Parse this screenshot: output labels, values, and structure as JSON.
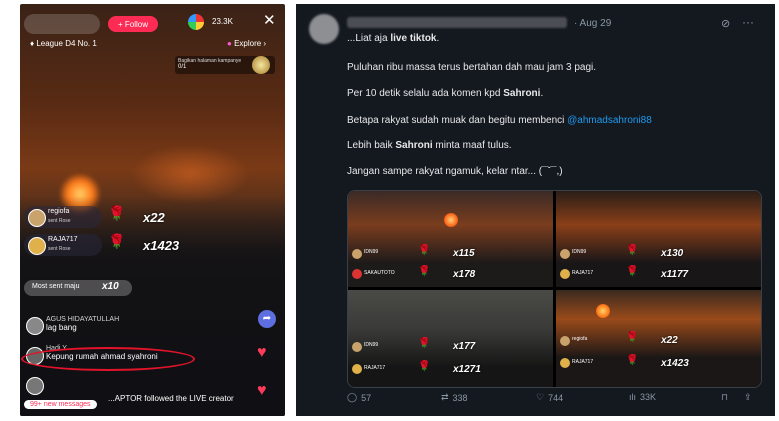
{
  "tiktok": {
    "follow_label": "+ Follow",
    "viewer_count": "23.3K",
    "league": "League D4 No. 1",
    "explore": "Explore",
    "share_page": "Bagikan halaman kampanye",
    "share_count": "0/1",
    "gifts": [
      {
        "user": "regiofa",
        "sub": "sent Rose",
        "count": "x22"
      },
      {
        "user": "RAJA717",
        "sub": "sent Rose",
        "count": "x1423"
      }
    ],
    "most_sent": "Most sent maju",
    "most_sent_count": "x10",
    "comments": [
      {
        "name": "AGUS HIDAYATULLAH",
        "text": "lag bang"
      },
      {
        "name": "Hadi Y...",
        "text": "Kepung rumah ahmad syahroni"
      }
    ],
    "followed_text": "...APTOR followed the LIVE creator",
    "new_messages": "99+ new messages"
  },
  "tweet": {
    "date": "· Aug 29",
    "lines": [
      {
        "pre": "...Liat aja ",
        "bold": "live tiktok",
        "post": "."
      },
      {
        "pre": "Puluhan ribu massa terus bertahan dah mau jam 3 pagi.",
        "bold": "",
        "post": ""
      },
      {
        "pre": "Per 10 detik selalu ada komen kpd ",
        "bold": "Sahroni",
        "post": "."
      },
      {
        "pre": "Betapa rakyat sudah muak dan begitu membenci ",
        "bold": "",
        "post": "",
        "mention": "@ahmadsahroni88"
      },
      {
        "pre": "Lebih baik ",
        "bold": "Sahroni",
        "post": " minta maaf tulus."
      },
      {
        "pre": "Jangan sampe rakyat ngamuk, kelar ntar... (¯ˇ¯,)",
        "bold": "",
        "post": ""
      }
    ],
    "images": [
      {
        "gifts": [
          {
            "user": "IDN99",
            "count": "x115"
          },
          {
            "user": "SAKAUTOTO",
            "count": "x178"
          }
        ]
      },
      {
        "gifts": [
          {
            "user": "IDN99",
            "count": "x130"
          },
          {
            "user": "RAJA717",
            "count": "x1177"
          }
        ]
      },
      {
        "gifts": [
          {
            "user": "IDN99",
            "count": "x177"
          },
          {
            "user": "RAJA717",
            "count": "x1271"
          }
        ]
      },
      {
        "gifts": [
          {
            "user": "regiofa",
            "count": "x22"
          },
          {
            "user": "RAJA717",
            "count": "x1423"
          }
        ]
      }
    ],
    "actions": {
      "replies": "57",
      "retweets": "338",
      "likes": "744",
      "views": "33K"
    }
  }
}
